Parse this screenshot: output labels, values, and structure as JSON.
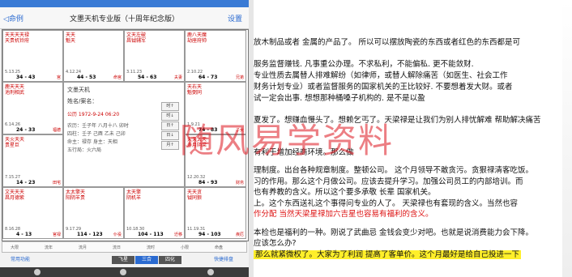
{
  "app": {
    "back_label": "◁命例",
    "title": "文墨天机专业版（十周年纪念版）",
    "settings_label": "设置"
  },
  "palaces": [
    {
      "stars": "天天天天禄\n天贵机铃府",
      "age": "5.13.25",
      "range": "34 - 43",
      "pname": "宫"
    },
    {
      "stars": "天天\n魁天",
      "age": "4.12.24",
      "range": "44 - 53",
      "pname": "命宫"
    },
    {
      "stars": "文天左破\n昌钺辅军",
      "age": "3.11.23",
      "range": "54 - 63",
      "pname": "夫妻"
    },
    {
      "stars": "鹿八天魔\n劫座府帅",
      "age": "2.10.22",
      "range": "64 - 73",
      "pname": "兄弟"
    },
    {
      "stars": "鹿天天天\n池刑相武",
      "age": "6.14.26",
      "range": "24 - 33",
      "pname": "福德"
    },
    {
      "stars": "天右天\n魁弼同",
      "age": "1.9.21",
      "range": "74 - 83",
      "pname": "子女"
    },
    {
      "stars": "天火天天\n贵星巨",
      "age": "7.15.27",
      "range": "14 - 23",
      "pname": "田宅"
    },
    {
      "stars": "天天太天\n寿月阴梁",
      "age": "12.20.32",
      "range": "84 - 93",
      "pname": "财帛"
    },
    {
      "stars": "文天天天\n昌月德紫",
      "age": "8.16.28",
      "range": "4 - 13",
      "pname": "官禄"
    },
    {
      "stars": "太太擎天\n阳阴羊贵",
      "age": "9.17.29",
      "range": "114 - 123",
      "pname": "仆役"
    },
    {
      "stars": "太天擎\n阴机羊",
      "age": "10.18.30",
      "range": "104 - 113",
      "pname": "迁移"
    },
    {
      "stars": "天天贪\n钺同狼",
      "age": "11.19.31",
      "range": "94 - 103",
      "pname": "疾厄"
    }
  ],
  "center": {
    "title": "文墨天机",
    "name": "姓名/案名：",
    "date": "公历 1972-9-24 06:20",
    "lines": [
      "农历：壬子年 八月十八 卯时",
      "四柱：壬子 己酉 乙未 己卯",
      "命主：禄存 身主：天相",
      "五行局：火六局"
    ],
    "buttons": [
      "时↑",
      "时↓",
      "日↑",
      "日↓",
      "月↑"
    ]
  },
  "bottom_row1": [
    "大限",
    "流年",
    "流月",
    "流日",
    "流时",
    "小限",
    "命盘"
  ],
  "bottom_row2": {
    "left": "常用功能",
    "segments": [
      "飞星",
      "三合",
      "四化"
    ],
    "right": "快捷排盘"
  },
  "doc": {
    "lines": [
      "放木制品或者 金属的产品了。 所以可以摆放陶瓷的东西或者红色的东西都是可",
      "服务监督赚钱. 凡事重公办理。不求私利，不能偏私. 更不能敛财.",
      "专业性质去属替人排难解纷（如律师，或替人解除痛苦（如医生、社会工作",
      "   财务计划专业）或者监督服务的国家机关的王比较好. 不要想着发大财。或者",
      "试一定会出事. 想想那种桶嗓子机构的. 是不是以盈",
      "夏发了。想赚血慢头了。想赖乞丐了。天梁禄是让我们为别人排忧解难 帮助解决痛苦",
      "",
      "",
      "                                              有利于增加经商环境。那么做",
      "理制度。出台各种规章制度。整顿公司。 这个月领导不敢贪污。贪狠禄清客吃饭。",
      "习的作用。那么这个月做公司。应该去提升学习。加强公司员工的内部培训。而",
      "也有养教的含义。所以这个要多承敬 长辈 国家机关。",
      "上。这个东西送礼这个事得问专业的人了。 天梁禄也有套现的含义。当然也容",
      "作分配 当然天梁星禄加六吉星也容易有福利的含义。",
      "",
      "本检也是福利的一种。刚说了武曲忌 金钱会变少对吧。也就是说消费能力会下降。",
      "应该怎么办?",
      "那么就紧微权了。大家为了利润 提高了客单价。这个月最好是给自己投进一下"
    ],
    "watermark": "随风易学资料"
  }
}
